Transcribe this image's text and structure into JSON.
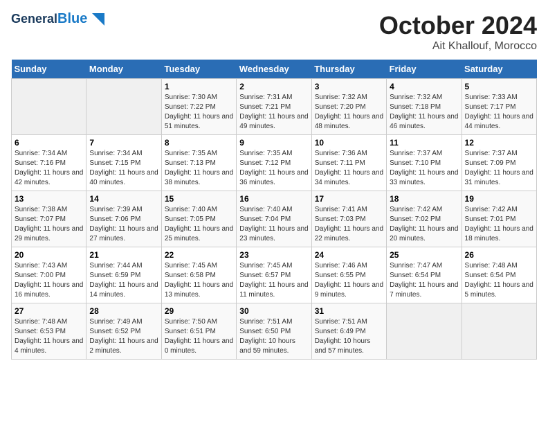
{
  "header": {
    "logo_line1": "General",
    "logo_line2": "Blue",
    "title": "October 2024",
    "subtitle": "Ait Khallouf, Morocco"
  },
  "columns": [
    "Sunday",
    "Monday",
    "Tuesday",
    "Wednesday",
    "Thursday",
    "Friday",
    "Saturday"
  ],
  "weeks": [
    [
      {
        "day": "",
        "sunrise": "",
        "sunset": "",
        "daylight": ""
      },
      {
        "day": "",
        "sunrise": "",
        "sunset": "",
        "daylight": ""
      },
      {
        "day": "1",
        "sunrise": "Sunrise: 7:30 AM",
        "sunset": "Sunset: 7:22 PM",
        "daylight": "Daylight: 11 hours and 51 minutes."
      },
      {
        "day": "2",
        "sunrise": "Sunrise: 7:31 AM",
        "sunset": "Sunset: 7:21 PM",
        "daylight": "Daylight: 11 hours and 49 minutes."
      },
      {
        "day": "3",
        "sunrise": "Sunrise: 7:32 AM",
        "sunset": "Sunset: 7:20 PM",
        "daylight": "Daylight: 11 hours and 48 minutes."
      },
      {
        "day": "4",
        "sunrise": "Sunrise: 7:32 AM",
        "sunset": "Sunset: 7:18 PM",
        "daylight": "Daylight: 11 hours and 46 minutes."
      },
      {
        "day": "5",
        "sunrise": "Sunrise: 7:33 AM",
        "sunset": "Sunset: 7:17 PM",
        "daylight": "Daylight: 11 hours and 44 minutes."
      }
    ],
    [
      {
        "day": "6",
        "sunrise": "Sunrise: 7:34 AM",
        "sunset": "Sunset: 7:16 PM",
        "daylight": "Daylight: 11 hours and 42 minutes."
      },
      {
        "day": "7",
        "sunrise": "Sunrise: 7:34 AM",
        "sunset": "Sunset: 7:15 PM",
        "daylight": "Daylight: 11 hours and 40 minutes."
      },
      {
        "day": "8",
        "sunrise": "Sunrise: 7:35 AM",
        "sunset": "Sunset: 7:13 PM",
        "daylight": "Daylight: 11 hours and 38 minutes."
      },
      {
        "day": "9",
        "sunrise": "Sunrise: 7:35 AM",
        "sunset": "Sunset: 7:12 PM",
        "daylight": "Daylight: 11 hours and 36 minutes."
      },
      {
        "day": "10",
        "sunrise": "Sunrise: 7:36 AM",
        "sunset": "Sunset: 7:11 PM",
        "daylight": "Daylight: 11 hours and 34 minutes."
      },
      {
        "day": "11",
        "sunrise": "Sunrise: 7:37 AM",
        "sunset": "Sunset: 7:10 PM",
        "daylight": "Daylight: 11 hours and 33 minutes."
      },
      {
        "day": "12",
        "sunrise": "Sunrise: 7:37 AM",
        "sunset": "Sunset: 7:09 PM",
        "daylight": "Daylight: 11 hours and 31 minutes."
      }
    ],
    [
      {
        "day": "13",
        "sunrise": "Sunrise: 7:38 AM",
        "sunset": "Sunset: 7:07 PM",
        "daylight": "Daylight: 11 hours and 29 minutes."
      },
      {
        "day": "14",
        "sunrise": "Sunrise: 7:39 AM",
        "sunset": "Sunset: 7:06 PM",
        "daylight": "Daylight: 11 hours and 27 minutes."
      },
      {
        "day": "15",
        "sunrise": "Sunrise: 7:40 AM",
        "sunset": "Sunset: 7:05 PM",
        "daylight": "Daylight: 11 hours and 25 minutes."
      },
      {
        "day": "16",
        "sunrise": "Sunrise: 7:40 AM",
        "sunset": "Sunset: 7:04 PM",
        "daylight": "Daylight: 11 hours and 23 minutes."
      },
      {
        "day": "17",
        "sunrise": "Sunrise: 7:41 AM",
        "sunset": "Sunset: 7:03 PM",
        "daylight": "Daylight: 11 hours and 22 minutes."
      },
      {
        "day": "18",
        "sunrise": "Sunrise: 7:42 AM",
        "sunset": "Sunset: 7:02 PM",
        "daylight": "Daylight: 11 hours and 20 minutes."
      },
      {
        "day": "19",
        "sunrise": "Sunrise: 7:42 AM",
        "sunset": "Sunset: 7:01 PM",
        "daylight": "Daylight: 11 hours and 18 minutes."
      }
    ],
    [
      {
        "day": "20",
        "sunrise": "Sunrise: 7:43 AM",
        "sunset": "Sunset: 7:00 PM",
        "daylight": "Daylight: 11 hours and 16 minutes."
      },
      {
        "day": "21",
        "sunrise": "Sunrise: 7:44 AM",
        "sunset": "Sunset: 6:59 PM",
        "daylight": "Daylight: 11 hours and 14 minutes."
      },
      {
        "day": "22",
        "sunrise": "Sunrise: 7:45 AM",
        "sunset": "Sunset: 6:58 PM",
        "daylight": "Daylight: 11 hours and 13 minutes."
      },
      {
        "day": "23",
        "sunrise": "Sunrise: 7:45 AM",
        "sunset": "Sunset: 6:57 PM",
        "daylight": "Daylight: 11 hours and 11 minutes."
      },
      {
        "day": "24",
        "sunrise": "Sunrise: 7:46 AM",
        "sunset": "Sunset: 6:55 PM",
        "daylight": "Daylight: 11 hours and 9 minutes."
      },
      {
        "day": "25",
        "sunrise": "Sunrise: 7:47 AM",
        "sunset": "Sunset: 6:54 PM",
        "daylight": "Daylight: 11 hours and 7 minutes."
      },
      {
        "day": "26",
        "sunrise": "Sunrise: 7:48 AM",
        "sunset": "Sunset: 6:54 PM",
        "daylight": "Daylight: 11 hours and 5 minutes."
      }
    ],
    [
      {
        "day": "27",
        "sunrise": "Sunrise: 7:48 AM",
        "sunset": "Sunset: 6:53 PM",
        "daylight": "Daylight: 11 hours and 4 minutes."
      },
      {
        "day": "28",
        "sunrise": "Sunrise: 7:49 AM",
        "sunset": "Sunset: 6:52 PM",
        "daylight": "Daylight: 11 hours and 2 minutes."
      },
      {
        "day": "29",
        "sunrise": "Sunrise: 7:50 AM",
        "sunset": "Sunset: 6:51 PM",
        "daylight": "Daylight: 11 hours and 0 minutes."
      },
      {
        "day": "30",
        "sunrise": "Sunrise: 7:51 AM",
        "sunset": "Sunset: 6:50 PM",
        "daylight": "Daylight: 10 hours and 59 minutes."
      },
      {
        "day": "31",
        "sunrise": "Sunrise: 7:51 AM",
        "sunset": "Sunset: 6:49 PM",
        "daylight": "Daylight: 10 hours and 57 minutes."
      },
      {
        "day": "",
        "sunrise": "",
        "sunset": "",
        "daylight": ""
      },
      {
        "day": "",
        "sunrise": "",
        "sunset": "",
        "daylight": ""
      }
    ]
  ]
}
